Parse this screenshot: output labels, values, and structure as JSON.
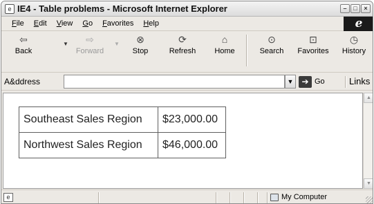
{
  "window": {
    "title": "IE4 - Table problems - Microsoft Internet Explorer",
    "app_icon": "ie-document-icon"
  },
  "menu": {
    "items": [
      "File",
      "Edit",
      "View",
      "Go",
      "Favorites",
      "Help"
    ]
  },
  "toolbar": {
    "buttons": [
      {
        "label": "Back",
        "icon": "back-arrow-icon",
        "enabled": true
      },
      {
        "label": "Forward",
        "icon": "forward-arrow-icon",
        "enabled": false
      },
      {
        "label": "Stop",
        "icon": "stop-icon",
        "enabled": true
      },
      {
        "label": "Refresh",
        "icon": "refresh-icon",
        "enabled": true
      },
      {
        "label": "Home",
        "icon": "home-icon",
        "enabled": true
      },
      {
        "label": "Search",
        "icon": "search-icon",
        "enabled": true
      },
      {
        "label": "Favorites",
        "icon": "favorites-icon",
        "enabled": true
      },
      {
        "label": "History",
        "icon": "history-icon",
        "enabled": true
      }
    ]
  },
  "address": {
    "label": "A&ddress",
    "value": "",
    "go_label": "Go",
    "links_label": "Links"
  },
  "table": {
    "rows": [
      {
        "region": "Southeast Sales Region",
        "amount": "$23,000.00"
      },
      {
        "region": "Northwest Sales Region",
        "amount": "$46,000.00"
      }
    ]
  },
  "status": {
    "zone": "My Computer"
  }
}
